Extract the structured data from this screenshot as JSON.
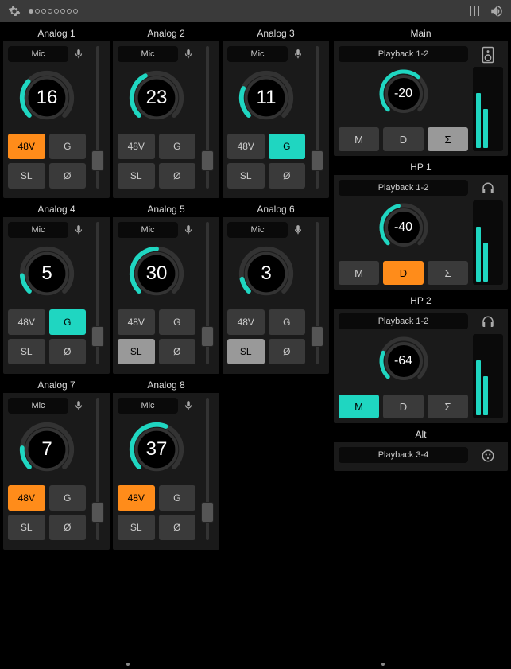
{
  "inputs": [
    {
      "title": "Analog 1",
      "source": "Mic",
      "value": "16",
      "arc": 0.32,
      "buttons": [
        {
          "label": "48V",
          "state": "orange"
        },
        {
          "label": "G",
          "state": ""
        },
        {
          "label": "SL",
          "state": ""
        },
        {
          "label": "Ø",
          "state": ""
        }
      ],
      "fader": 0.15
    },
    {
      "title": "Analog 2",
      "source": "Mic",
      "value": "23",
      "arc": 0.4,
      "buttons": [
        {
          "label": "48V",
          "state": ""
        },
        {
          "label": "G",
          "state": ""
        },
        {
          "label": "SL",
          "state": ""
        },
        {
          "label": "Ø",
          "state": ""
        }
      ],
      "fader": 0.15
    },
    {
      "title": "Analog 3",
      "source": "Mic",
      "value": "11",
      "arc": 0.25,
      "buttons": [
        {
          "label": "48V",
          "state": ""
        },
        {
          "label": "G",
          "state": "teal"
        },
        {
          "label": "SL",
          "state": ""
        },
        {
          "label": "Ø",
          "state": ""
        }
      ],
      "fader": 0.15
    },
    {
      "title": "Analog 4",
      "source": "Mic",
      "value": "5",
      "arc": 0.15,
      "buttons": [
        {
          "label": "48V",
          "state": ""
        },
        {
          "label": "G",
          "state": "teal"
        },
        {
          "label": "SL",
          "state": ""
        },
        {
          "label": "Ø",
          "state": ""
        }
      ],
      "fader": 0.15
    },
    {
      "title": "Analog 5",
      "source": "Mic",
      "value": "30",
      "arc": 0.5,
      "buttons": [
        {
          "label": "48V",
          "state": ""
        },
        {
          "label": "G",
          "state": ""
        },
        {
          "label": "SL",
          "state": "light"
        },
        {
          "label": "Ø",
          "state": ""
        }
      ],
      "fader": 0.15
    },
    {
      "title": "Analog 6",
      "source": "Mic",
      "value": "3",
      "arc": 0.12,
      "buttons": [
        {
          "label": "48V",
          "state": ""
        },
        {
          "label": "G",
          "state": ""
        },
        {
          "label": "SL",
          "state": "light"
        },
        {
          "label": "Ø",
          "state": ""
        }
      ],
      "fader": 0.15
    },
    {
      "title": "Analog 7",
      "source": "Mic",
      "value": "7",
      "arc": 0.18,
      "buttons": [
        {
          "label": "48V",
          "state": "orange"
        },
        {
          "label": "G",
          "state": ""
        },
        {
          "label": "SL",
          "state": ""
        },
        {
          "label": "Ø",
          "state": ""
        }
      ],
      "fader": 0.15
    },
    {
      "title": "Analog 8",
      "source": "Mic",
      "value": "37",
      "arc": 0.58,
      "buttons": [
        {
          "label": "48V",
          "state": "orange"
        },
        {
          "label": "G",
          "state": ""
        },
        {
          "label": "SL",
          "state": ""
        },
        {
          "label": "Ø",
          "state": ""
        }
      ],
      "fader": 0.15
    }
  ],
  "outputs": [
    {
      "title": "Main",
      "playback": "Playback 1-2",
      "value": "-20",
      "arc": 0.65,
      "icon": "speaker",
      "buttons": [
        {
          "label": "M",
          "state": ""
        },
        {
          "label": "D",
          "state": ""
        },
        {
          "label": "Σ",
          "state": "light"
        }
      ],
      "meters": [
        {
          "h": 0.7,
          "c": "#1fd6c1"
        },
        {
          "h": 0.5,
          "c": "#1fd6c1"
        }
      ]
    },
    {
      "title": "HP 1",
      "playback": "Playback 1-2",
      "value": "-40",
      "arc": 0.45,
      "icon": "headphones",
      "buttons": [
        {
          "label": "M",
          "state": ""
        },
        {
          "label": "D",
          "state": "orange"
        },
        {
          "label": "Σ",
          "state": ""
        }
      ],
      "meters": [
        {
          "h": 0.7,
          "c": "#1fd6c1"
        },
        {
          "h": 0.5,
          "c": "#1fd6c1"
        }
      ]
    },
    {
      "title": "HP 2",
      "playback": "Playback 1-2",
      "value": "-64",
      "arc": 0.25,
      "icon": "headphones",
      "buttons": [
        {
          "label": "M",
          "state": "teal"
        },
        {
          "label": "D",
          "state": ""
        },
        {
          "label": "Σ",
          "state": ""
        }
      ],
      "meters": [
        {
          "h": 0.7,
          "c": "#1fd6c1"
        },
        {
          "h": 0.5,
          "c": "#1fd6c1"
        }
      ]
    },
    {
      "title": "Alt",
      "playback": "Playback 3-4",
      "value": "",
      "arc": 0,
      "icon": "alt",
      "buttons": [],
      "meters": [],
      "compact": true
    }
  ],
  "colors": {
    "teal": "#1fd6c1",
    "orange": "#ff8c1a",
    "track": "#333"
  }
}
